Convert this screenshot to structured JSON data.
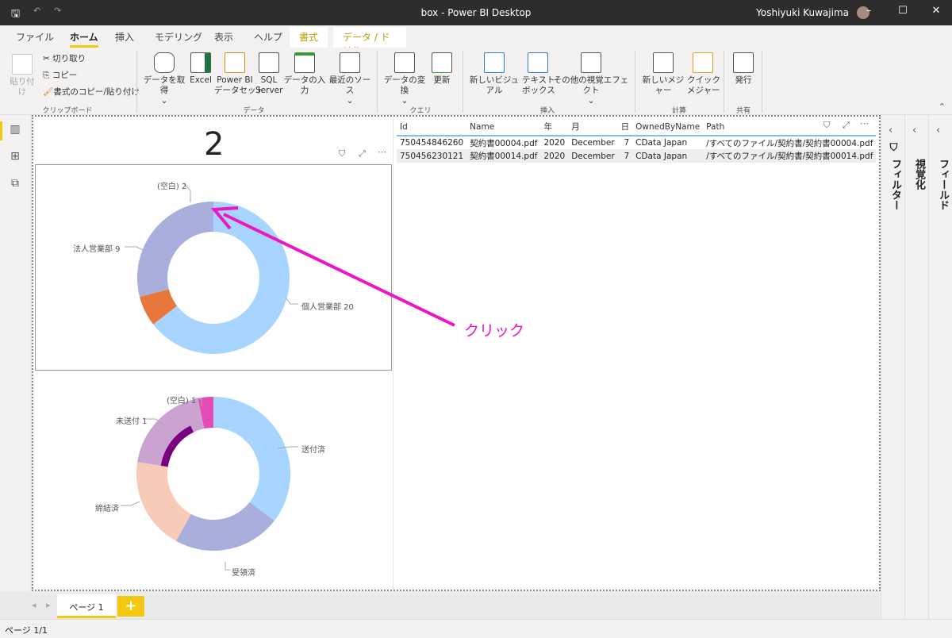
{
  "window": {
    "title": "box - Power BI Desktop",
    "user": "Yoshiyuki Kuwajima"
  },
  "tabs": [
    "ファイル",
    "ホーム",
    "挿入",
    "モデリング",
    "表示",
    "ヘルプ",
    "書式",
    "データ / ドリル"
  ],
  "ribbon": {
    "clipboard": {
      "paste": "貼り付け",
      "cut": "切り取り",
      "copy": "コピー",
      "format_painter": "書式のコピー/貼り付け",
      "group": "クリップボード"
    },
    "data": {
      "get_data": "データを取得",
      "excel": "Excel",
      "pbi_dataset": "Power BI\nデータセット",
      "sql": "SQL\nServer",
      "enter_data": "データの入力",
      "recent": "最近のソース",
      "group": "データ"
    },
    "query": {
      "transform": "データの変換",
      "refresh": "更新",
      "group": "クエリ"
    },
    "insert": {
      "new_visual": "新しいビジュアル",
      "textbox": "テキスト\nボックス",
      "more_visuals": "その他の視覚エフェクト",
      "group": "挿入"
    },
    "calc": {
      "new_measure": "新しいメジャー",
      "quick_measure": "クイック\nメジャー",
      "group": "計算"
    },
    "share": {
      "publish": "発行",
      "group": "共有"
    }
  },
  "card": {
    "value": "2"
  },
  "table": {
    "columns": [
      "Id",
      "Name",
      "年",
      "月",
      "日",
      "OwnedByName",
      "Path"
    ],
    "rows": [
      [
        "750454846260",
        "契約書00004.pdf",
        "2020",
        "December",
        "7",
        "CData Japan",
        "/すべてのファイル/契約書/契約書00004.pdf"
      ],
      [
        "750456230121",
        "契約書00014.pdf",
        "2020",
        "December",
        "7",
        "CData Japan",
        "/すべてのファイル/契約書/契約書00014.pdf"
      ]
    ]
  },
  "chart_data": [
    {
      "type": "pie",
      "donut": true,
      "categories": [
        "個人営業部",
        "(空白)",
        "法人営業部"
      ],
      "values": [
        20,
        2,
        9
      ],
      "labels": [
        "個人営業部 20",
        "(空白) 2",
        "法人営業部 9"
      ],
      "colors": [
        "#a7d5ff",
        "#e8773c",
        "#a9aedd"
      ],
      "selected": "(空白)"
    },
    {
      "type": "pie",
      "donut": true,
      "categories": [
        "送付済",
        "受領済",
        "締結済",
        "未送付",
        "(空白)"
      ],
      "values": [
        11,
        7,
        6,
        6,
        1
      ],
      "highlighted": [
        0,
        0,
        0,
        1,
        1
      ],
      "labels": [
        "送付済",
        "受領済",
        "締結済",
        "未送付 1",
        "(空白) 1"
      ],
      "colors": [
        "#a7d5ff",
        "#a9aedd",
        "#f7cbb8",
        "#cba3d0",
        "#e44bb5"
      ],
      "highlight_color": "#7a0080"
    }
  ],
  "annotation": {
    "text": "クリック",
    "color": "#ee14c8"
  },
  "panes": {
    "filters": "フィルター",
    "visualizations": "視覚化",
    "fields": "フィールド"
  },
  "pages": {
    "current": "ページ 1",
    "add": "+"
  },
  "status": "ページ 1/1"
}
